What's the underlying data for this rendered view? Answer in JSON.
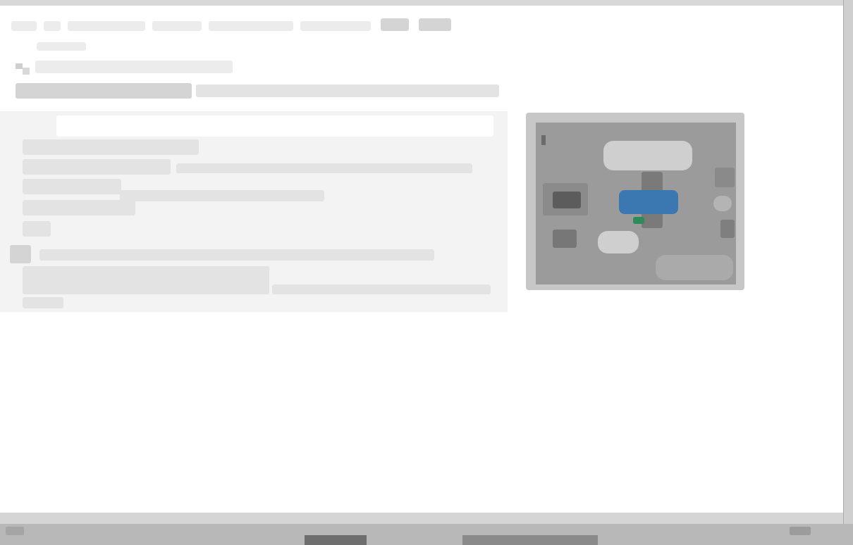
{
  "colors": {
    "page_bg": "#ffffff",
    "thumbnail_accent": "#3b77b0",
    "thumbnail_accent_2": "#2f8a5b",
    "taskbar": "#b8b8b8"
  },
  "header": {
    "logo_icon": "app-logo-icon",
    "nav_links": [],
    "breadcrumb": ""
  },
  "article": {
    "title": "",
    "lines": []
  },
  "thumbnail": {
    "caption": ""
  },
  "taskbar": {
    "start_icon": "start-icon",
    "tasks": [],
    "clock": ""
  }
}
